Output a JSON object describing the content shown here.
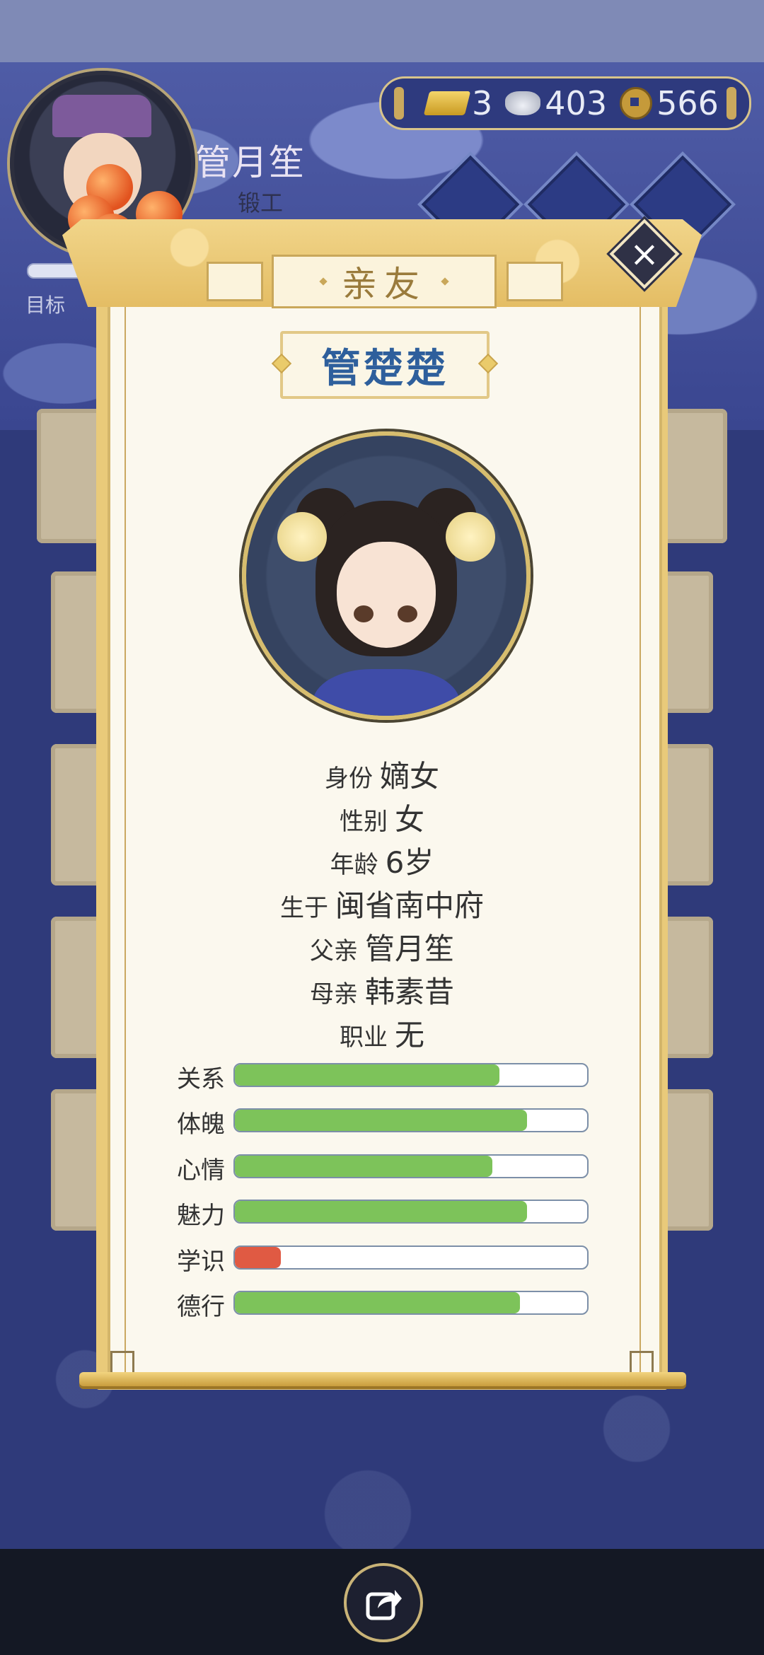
{
  "player": {
    "name": "管月笙",
    "job": "锻工",
    "goal_label": "目标"
  },
  "currency": {
    "gold": "3",
    "silver": "403",
    "coins": "566"
  },
  "dialog": {
    "title": "亲友",
    "character_name": "管楚楚",
    "info": [
      {
        "key": "身份",
        "value": "嫡女"
      },
      {
        "key": "性别",
        "value": "女"
      },
      {
        "key": "年龄",
        "value": "6岁"
      },
      {
        "key": "生于",
        "value": "闽省南中府"
      },
      {
        "key": "父亲",
        "value": "管月笙"
      },
      {
        "key": "母亲",
        "value": "韩素昔"
      },
      {
        "key": "职业",
        "value": "无"
      }
    ],
    "stats": [
      {
        "label": "关系",
        "fraction": 0.75,
        "color": "#7dc35a"
      },
      {
        "label": "体魄",
        "fraction": 0.83,
        "color": "#7dc35a"
      },
      {
        "label": "心情",
        "fraction": 0.73,
        "color": "#7dc35a"
      },
      {
        "label": "魅力",
        "fraction": 0.83,
        "color": "#7dc35a"
      },
      {
        "label": "学识",
        "fraction": 0.13,
        "color": "#e05a43"
      },
      {
        "label": "德行",
        "fraction": 0.81,
        "color": "#7dc35a"
      }
    ]
  },
  "icons": {
    "close": "close-icon",
    "share": "share-icon",
    "gold": "gold-ingot-icon",
    "silver": "silver-ingot-icon",
    "coin": "copper-coin-icon"
  }
}
